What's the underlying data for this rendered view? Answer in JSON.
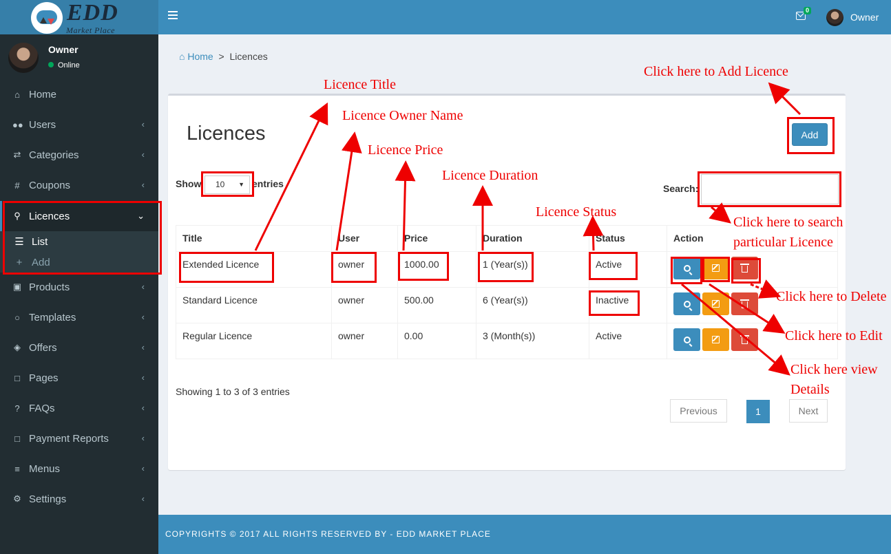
{
  "brand": {
    "name": "EDD",
    "tagline": "Market Place"
  },
  "topbar": {
    "mail_count": "0",
    "user_name": "Owner"
  },
  "sidebar": {
    "user": {
      "name": "Owner",
      "status": "Online"
    },
    "items": [
      {
        "label": "Home",
        "icon": "home-icon"
      },
      {
        "label": "Users",
        "icon": "users-icon"
      },
      {
        "label": "Categories",
        "icon": "shuffle-icon"
      },
      {
        "label": "Coupons",
        "icon": "hash-icon"
      },
      {
        "label": "Licences",
        "icon": "key-icon"
      },
      {
        "label": "Products",
        "icon": "shopping-bag-icon"
      },
      {
        "label": "Templates",
        "icon": "comment-icon"
      },
      {
        "label": "Offers",
        "icon": "tags-icon"
      },
      {
        "label": "Pages",
        "icon": "file-icon"
      },
      {
        "label": "FAQs",
        "icon": "question-icon"
      },
      {
        "label": "Payment Reports",
        "icon": "file-icon"
      },
      {
        "label": "Menus",
        "icon": "bars-icon"
      },
      {
        "label": "Settings",
        "icon": "gear-icon"
      }
    ],
    "submenu": {
      "list": "List",
      "add": "Add"
    }
  },
  "breadcrumb": {
    "home": "Home",
    "separator": ">",
    "current": "Licences"
  },
  "page": {
    "title": "Licences",
    "add_label": "Add",
    "show": "Show",
    "entries": "entries",
    "page_length": "10",
    "search_label": "Search:",
    "search_value": "",
    "info": "Showing 1 to 3 of 3 entries",
    "pagination": {
      "prev": "Previous",
      "current": "1",
      "next": "Next"
    }
  },
  "table": {
    "headers": [
      "Title",
      "User",
      "Price",
      "Duration",
      "Status",
      "Action"
    ],
    "rows": [
      [
        "Extended Licence",
        "owner",
        "1000.00",
        "1 (Year(s))",
        "Active"
      ],
      [
        "Standard Licence",
        "owner",
        "500.00",
        "6 (Year(s))",
        "Inactive"
      ],
      [
        "Regular Licence",
        "owner",
        "0.00",
        "3 (Month(s))",
        "Active"
      ]
    ]
  },
  "footer": {
    "text": "COPYRIGHTS © 2017 ALL RIGHTS RESERVED BY - EDD MARKET PLACE"
  },
  "annotations": {
    "add": "Click here to Add Licence",
    "title": "Licence Title",
    "owner": "Licence Owner Name",
    "price": "Licence Price",
    "duration": "Licence Duration",
    "status": "Licence Status",
    "search_1": "Click here to search",
    "search_2": "particular Licence",
    "delete": "Click here to Delete",
    "edit": "Click here to Edit",
    "view_1": "Click here view",
    "view_2": "Details"
  },
  "colors": {
    "primary": "#3c8dbc",
    "sidebar": "#222d32",
    "warning": "#f39c12",
    "danger": "#dd4b39",
    "annotation": "#ee0000"
  }
}
